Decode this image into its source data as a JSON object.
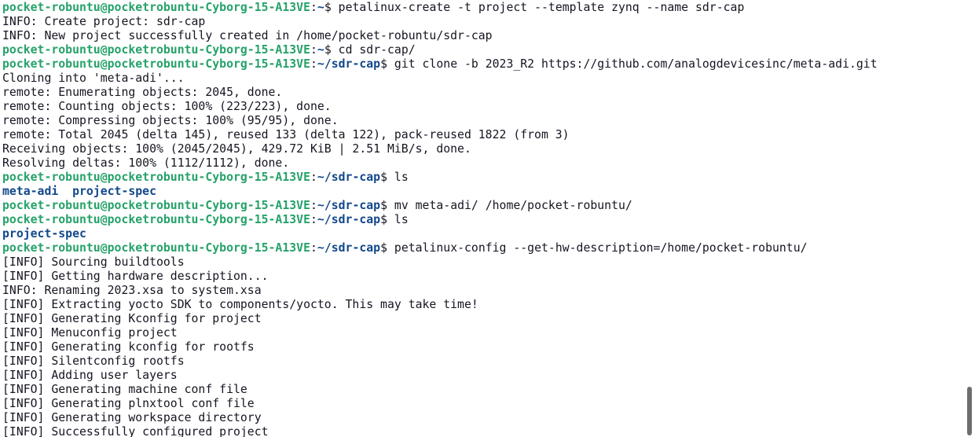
{
  "terminal": {
    "colors": {
      "background": "#ffffff",
      "foreground": "#171421",
      "prompt_user": "#26a269",
      "prompt_path": "#12488b",
      "directory": "#12488b"
    },
    "lines": [
      {
        "type": "prompt",
        "user": "pocket-robuntu@pocketrobuntu-Cyborg-15-A13VE",
        "path": "~",
        "command": "petalinux-create -t project --template zynq --name sdr-cap"
      },
      {
        "type": "text",
        "text": "INFO: Create project: sdr-cap"
      },
      {
        "type": "text",
        "text": "INFO: New project successfully created in /home/pocket-robuntu/sdr-cap"
      },
      {
        "type": "prompt",
        "user": "pocket-robuntu@pocketrobuntu-Cyborg-15-A13VE",
        "path": "~",
        "command": "cd sdr-cap/"
      },
      {
        "type": "prompt",
        "user": "pocket-robuntu@pocketrobuntu-Cyborg-15-A13VE",
        "path": "~/sdr-cap",
        "command": "git clone -b 2023_R2 https://github.com/analogdevicesinc/meta-adi.git"
      },
      {
        "type": "text",
        "text": "Cloning into 'meta-adi'..."
      },
      {
        "type": "text",
        "text": "remote: Enumerating objects: 2045, done."
      },
      {
        "type": "text",
        "text": "remote: Counting objects: 100% (223/223), done."
      },
      {
        "type": "text",
        "text": "remote: Compressing objects: 100% (95/95), done."
      },
      {
        "type": "text",
        "text": "remote: Total 2045 (delta 145), reused 133 (delta 122), pack-reused 1822 (from 3)"
      },
      {
        "type": "text",
        "text": "Receiving objects: 100% (2045/2045), 429.72 KiB | 2.51 MiB/s, done."
      },
      {
        "type": "text",
        "text": "Resolving deltas: 100% (1112/1112), done."
      },
      {
        "type": "prompt",
        "user": "pocket-robuntu@pocketrobuntu-Cyborg-15-A13VE",
        "path": "~/sdr-cap",
        "command": "ls"
      },
      {
        "type": "dirs",
        "text": "meta-adi  project-spec"
      },
      {
        "type": "prompt",
        "user": "pocket-robuntu@pocketrobuntu-Cyborg-15-A13VE",
        "path": "~/sdr-cap",
        "command": "mv meta-adi/ /home/pocket-robuntu/"
      },
      {
        "type": "prompt",
        "user": "pocket-robuntu@pocketrobuntu-Cyborg-15-A13VE",
        "path": "~/sdr-cap",
        "command": "ls"
      },
      {
        "type": "dirs",
        "text": "project-spec"
      },
      {
        "type": "prompt",
        "user": "pocket-robuntu@pocketrobuntu-Cyborg-15-A13VE",
        "path": "~/sdr-cap",
        "command": "petalinux-config --get-hw-description=/home/pocket-robuntu/"
      },
      {
        "type": "text",
        "text": "[INFO] Sourcing buildtools"
      },
      {
        "type": "text",
        "text": "[INFO] Getting hardware description..."
      },
      {
        "type": "text",
        "text": "INFO: Renaming 2023.xsa to system.xsa"
      },
      {
        "type": "text",
        "text": "[INFO] Extracting yocto SDK to components/yocto. This may take time!"
      },
      {
        "type": "text",
        "text": "[INFO] Generating Kconfig for project"
      },
      {
        "type": "text",
        "text": "[INFO] Menuconfig project"
      },
      {
        "type": "text",
        "text": "[INFO] Generating kconfig for rootfs"
      },
      {
        "type": "text",
        "text": "[INFO] Silentconfig rootfs"
      },
      {
        "type": "text",
        "text": "[INFO] Adding user layers"
      },
      {
        "type": "text",
        "text": "[INFO] Generating machine conf file"
      },
      {
        "type": "text",
        "text": "[INFO] Generating plnxtool conf file"
      },
      {
        "type": "text",
        "text": "[INFO] Generating workspace directory"
      },
      {
        "type": "text",
        "text": "[INFO] Successfully configured project"
      }
    ]
  }
}
